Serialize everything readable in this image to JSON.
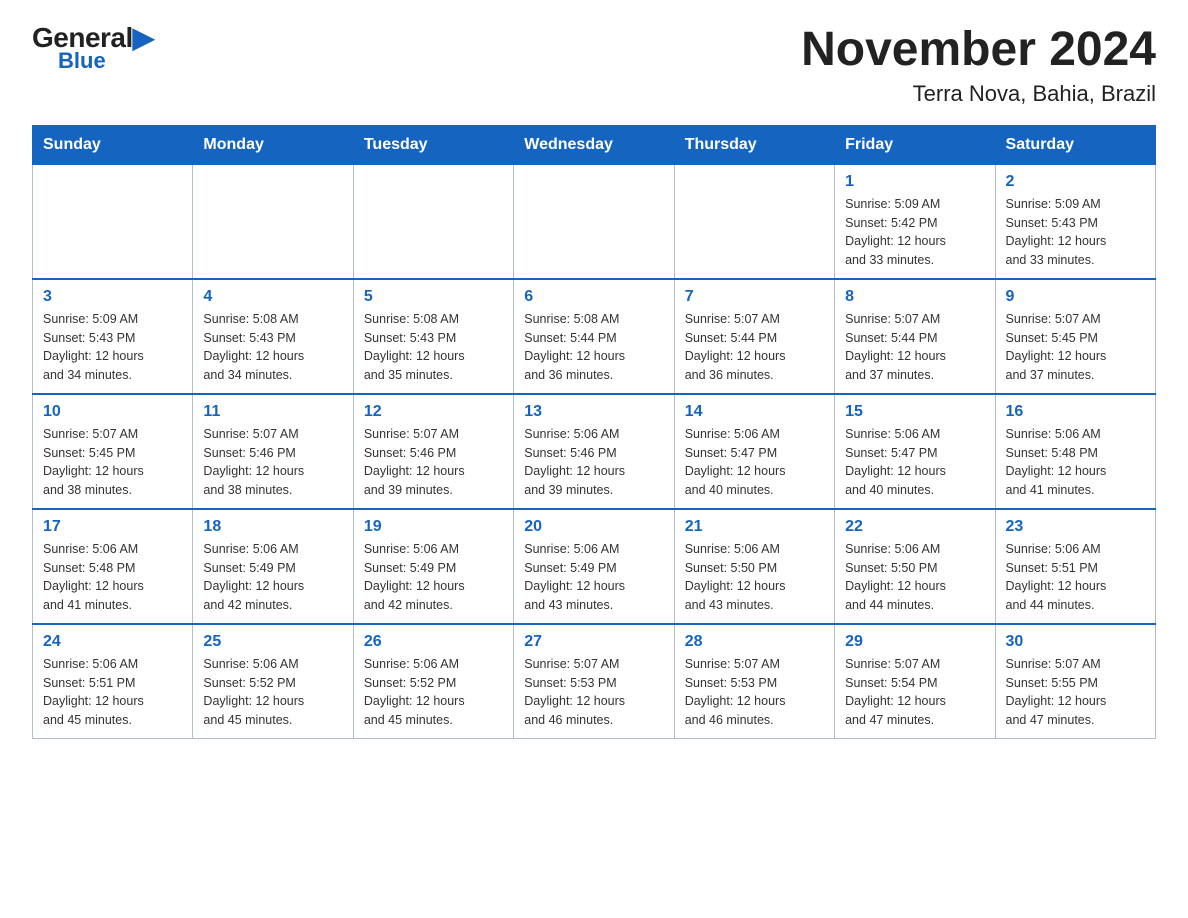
{
  "header": {
    "logo_general": "General",
    "logo_blue": "Blue",
    "title": "November 2024",
    "subtitle": "Terra Nova, Bahia, Brazil"
  },
  "weekdays": [
    "Sunday",
    "Monday",
    "Tuesday",
    "Wednesday",
    "Thursday",
    "Friday",
    "Saturday"
  ],
  "weeks": [
    [
      {
        "day": "",
        "info": ""
      },
      {
        "day": "",
        "info": ""
      },
      {
        "day": "",
        "info": ""
      },
      {
        "day": "",
        "info": ""
      },
      {
        "day": "",
        "info": ""
      },
      {
        "day": "1",
        "info": "Sunrise: 5:09 AM\nSunset: 5:42 PM\nDaylight: 12 hours\nand 33 minutes."
      },
      {
        "day": "2",
        "info": "Sunrise: 5:09 AM\nSunset: 5:43 PM\nDaylight: 12 hours\nand 33 minutes."
      }
    ],
    [
      {
        "day": "3",
        "info": "Sunrise: 5:09 AM\nSunset: 5:43 PM\nDaylight: 12 hours\nand 34 minutes."
      },
      {
        "day": "4",
        "info": "Sunrise: 5:08 AM\nSunset: 5:43 PM\nDaylight: 12 hours\nand 34 minutes."
      },
      {
        "day": "5",
        "info": "Sunrise: 5:08 AM\nSunset: 5:43 PM\nDaylight: 12 hours\nand 35 minutes."
      },
      {
        "day": "6",
        "info": "Sunrise: 5:08 AM\nSunset: 5:44 PM\nDaylight: 12 hours\nand 36 minutes."
      },
      {
        "day": "7",
        "info": "Sunrise: 5:07 AM\nSunset: 5:44 PM\nDaylight: 12 hours\nand 36 minutes."
      },
      {
        "day": "8",
        "info": "Sunrise: 5:07 AM\nSunset: 5:44 PM\nDaylight: 12 hours\nand 37 minutes."
      },
      {
        "day": "9",
        "info": "Sunrise: 5:07 AM\nSunset: 5:45 PM\nDaylight: 12 hours\nand 37 minutes."
      }
    ],
    [
      {
        "day": "10",
        "info": "Sunrise: 5:07 AM\nSunset: 5:45 PM\nDaylight: 12 hours\nand 38 minutes."
      },
      {
        "day": "11",
        "info": "Sunrise: 5:07 AM\nSunset: 5:46 PM\nDaylight: 12 hours\nand 38 minutes."
      },
      {
        "day": "12",
        "info": "Sunrise: 5:07 AM\nSunset: 5:46 PM\nDaylight: 12 hours\nand 39 minutes."
      },
      {
        "day": "13",
        "info": "Sunrise: 5:06 AM\nSunset: 5:46 PM\nDaylight: 12 hours\nand 39 minutes."
      },
      {
        "day": "14",
        "info": "Sunrise: 5:06 AM\nSunset: 5:47 PM\nDaylight: 12 hours\nand 40 minutes."
      },
      {
        "day": "15",
        "info": "Sunrise: 5:06 AM\nSunset: 5:47 PM\nDaylight: 12 hours\nand 40 minutes."
      },
      {
        "day": "16",
        "info": "Sunrise: 5:06 AM\nSunset: 5:48 PM\nDaylight: 12 hours\nand 41 minutes."
      }
    ],
    [
      {
        "day": "17",
        "info": "Sunrise: 5:06 AM\nSunset: 5:48 PM\nDaylight: 12 hours\nand 41 minutes."
      },
      {
        "day": "18",
        "info": "Sunrise: 5:06 AM\nSunset: 5:49 PM\nDaylight: 12 hours\nand 42 minutes."
      },
      {
        "day": "19",
        "info": "Sunrise: 5:06 AM\nSunset: 5:49 PM\nDaylight: 12 hours\nand 42 minutes."
      },
      {
        "day": "20",
        "info": "Sunrise: 5:06 AM\nSunset: 5:49 PM\nDaylight: 12 hours\nand 43 minutes."
      },
      {
        "day": "21",
        "info": "Sunrise: 5:06 AM\nSunset: 5:50 PM\nDaylight: 12 hours\nand 43 minutes."
      },
      {
        "day": "22",
        "info": "Sunrise: 5:06 AM\nSunset: 5:50 PM\nDaylight: 12 hours\nand 44 minutes."
      },
      {
        "day": "23",
        "info": "Sunrise: 5:06 AM\nSunset: 5:51 PM\nDaylight: 12 hours\nand 44 minutes."
      }
    ],
    [
      {
        "day": "24",
        "info": "Sunrise: 5:06 AM\nSunset: 5:51 PM\nDaylight: 12 hours\nand 45 minutes."
      },
      {
        "day": "25",
        "info": "Sunrise: 5:06 AM\nSunset: 5:52 PM\nDaylight: 12 hours\nand 45 minutes."
      },
      {
        "day": "26",
        "info": "Sunrise: 5:06 AM\nSunset: 5:52 PM\nDaylight: 12 hours\nand 45 minutes."
      },
      {
        "day": "27",
        "info": "Sunrise: 5:07 AM\nSunset: 5:53 PM\nDaylight: 12 hours\nand 46 minutes."
      },
      {
        "day": "28",
        "info": "Sunrise: 5:07 AM\nSunset: 5:53 PM\nDaylight: 12 hours\nand 46 minutes."
      },
      {
        "day": "29",
        "info": "Sunrise: 5:07 AM\nSunset: 5:54 PM\nDaylight: 12 hours\nand 47 minutes."
      },
      {
        "day": "30",
        "info": "Sunrise: 5:07 AM\nSunset: 5:55 PM\nDaylight: 12 hours\nand 47 minutes."
      }
    ]
  ]
}
